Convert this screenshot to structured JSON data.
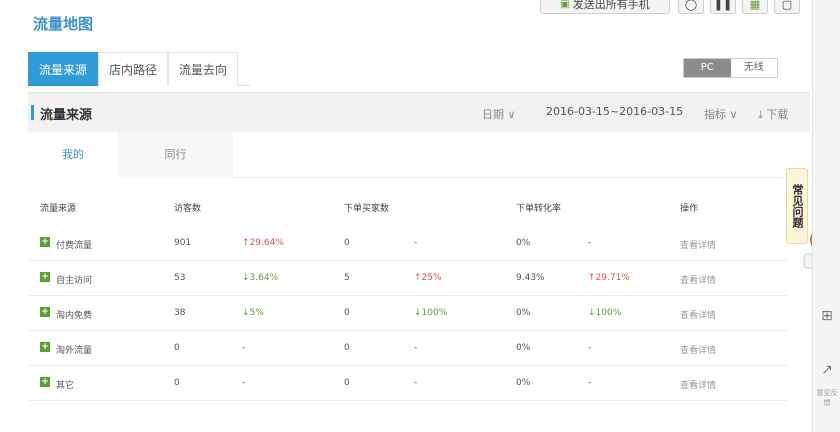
{
  "page_title": "流量地图",
  "top_buttons": {
    "main_label": "发送出所有手机"
  },
  "tabs": [
    {
      "label": "流量来源",
      "active": true
    },
    {
      "label": "店内路径",
      "active": false
    },
    {
      "label": "流量去向",
      "active": false
    }
  ],
  "device_toggle": {
    "pc": "PC",
    "wireless": "无线"
  },
  "section": {
    "title": "流量来源",
    "date_label": "日期",
    "date_range": "2016-03-15~2016-03-15",
    "metric_label": "指标",
    "download_label": "下载"
  },
  "subtabs": [
    {
      "label": "我的",
      "active": true
    },
    {
      "label": "同行",
      "active": false
    }
  ],
  "table": {
    "headers": [
      "流量来源",
      "访客数",
      "下单买家数",
      "下单转化率",
      "操作"
    ],
    "rows": [
      {
        "source": "付费流量",
        "visitors": "901",
        "visitors_change": "↑29.64%",
        "visitors_dir": "up",
        "buyers": "0",
        "buyers_change": "-",
        "buyers_dir": "none",
        "rate": "0%",
        "rate_change": "-",
        "rate_dir": "none",
        "action": "查看详情"
      },
      {
        "source": "自主访问",
        "visitors": "53",
        "visitors_change": "↓3.64%",
        "visitors_dir": "down",
        "buyers": "5",
        "buyers_change": "↑25%",
        "buyers_dir": "up",
        "rate": "9.43%",
        "rate_change": "↑29.71%",
        "rate_dir": "up",
        "action": "查看详情"
      },
      {
        "source": "淘内免费",
        "visitors": "38",
        "visitors_change": "↓5%",
        "visitors_dir": "down",
        "buyers": "0",
        "buyers_change": "↓100%",
        "buyers_dir": "down",
        "rate": "0%",
        "rate_change": "↓100%",
        "rate_dir": "down",
        "action": "查看详情"
      },
      {
        "source": "淘外流量",
        "visitors": "0",
        "visitors_change": "-",
        "visitors_dir": "none",
        "buyers": "0",
        "buyers_change": "-",
        "buyers_dir": "none",
        "rate": "0%",
        "rate_change": "-",
        "rate_dir": "none",
        "action": "查看详情"
      },
      {
        "source": "其它",
        "visitors": "0",
        "visitors_change": "-",
        "visitors_dir": "none",
        "buyers": "0",
        "buyers_change": "-",
        "buyers_dir": "none",
        "rate": "0%",
        "rate_change": "-",
        "rate_dir": "none",
        "action": "查看详情"
      }
    ]
  },
  "faq_label": "常见问题",
  "feedback_label": "意见反馈",
  "colors": {
    "accent": "#2f9bd8",
    "up": "#e0554a",
    "down": "#5fa033"
  }
}
